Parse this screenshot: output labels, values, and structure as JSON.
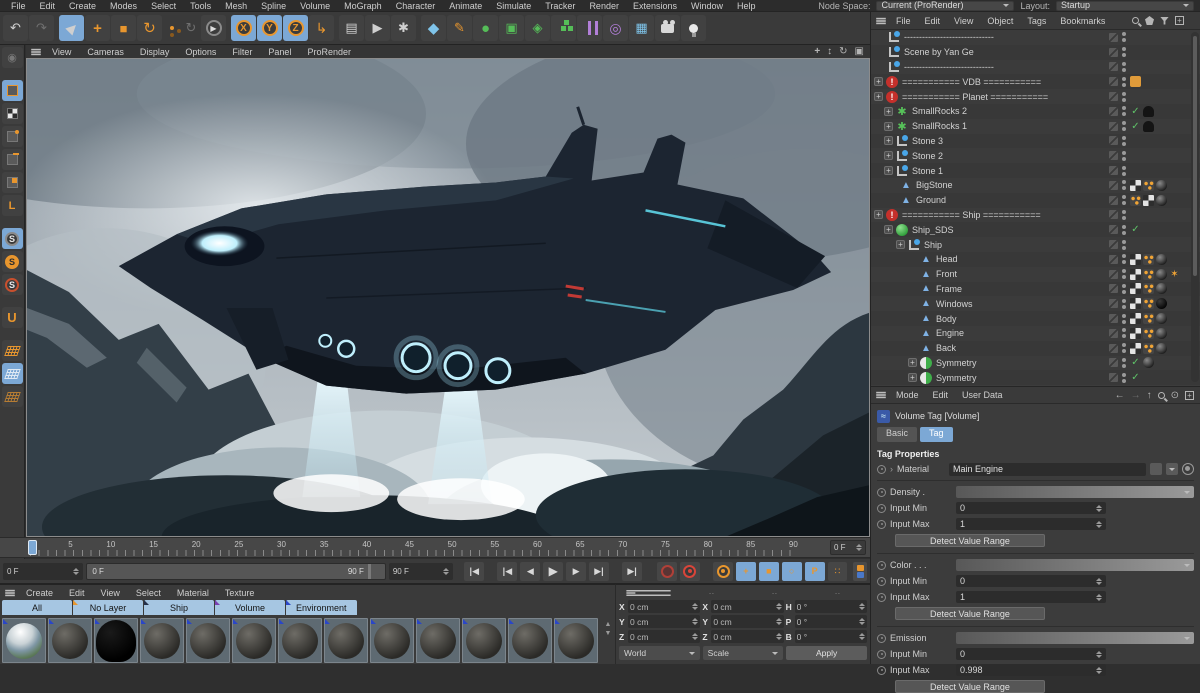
{
  "colors": {
    "highlight_blue": "#7ca8d5",
    "accent_orange": "#e8962e",
    "alert_red": "#c5302b",
    "check_green": "#5fc268",
    "tab_blue": "#a6c6e2",
    "engine_cyan": "#bfeffc"
  },
  "menubar": {
    "items": [
      "File",
      "Edit",
      "Create",
      "Modes",
      "Select",
      "Tools",
      "Mesh",
      "Spline",
      "Volume",
      "MoGraph",
      "Character",
      "Animate",
      "Simulate",
      "Tracker",
      "Render",
      "Extensions",
      "Window",
      "Help"
    ],
    "node_space_label": "Node Space:",
    "node_space_value": "Current (ProRender)",
    "layout_label": "Layout:",
    "layout_value": "Startup"
  },
  "icons": {
    "undo": "↶",
    "redo": "↷",
    "select": "▶",
    "move": "+",
    "scale": "■",
    "rotate": "↻",
    "x": "X",
    "y": "Y",
    "z": "Z",
    "axis": "↳",
    "render_view": "▤",
    "render_play": "▶",
    "render_settings": "✱",
    "cube": "◆",
    "pen": "✎",
    "sds": "●",
    "instance": "▣",
    "deform": "◈",
    "torus": "◎",
    "floor": "▦",
    "pan": "+",
    "dolly": "↕",
    "orbit": "↻",
    "maximize": "▣"
  },
  "viewport": {
    "menu": [
      "View",
      "Cameras",
      "Display",
      "Options",
      "Filter",
      "Panel",
      "ProRender"
    ]
  },
  "object_manager": {
    "menu": [
      "File",
      "Edit",
      "View",
      "Object",
      "Tags",
      "Bookmarks"
    ],
    "items": [
      {
        "label": "------------------------------"
      },
      {
        "label": "Scene by Yan Ge"
      },
      {
        "label": "------------------------------"
      },
      {
        "label": "=========== VDB ==========="
      },
      {
        "label": "=========== Planet ==========="
      },
      {
        "label": "SmallRocks 2"
      },
      {
        "label": "SmallRocks 1"
      },
      {
        "label": "Stone 3"
      },
      {
        "label": "Stone 2"
      },
      {
        "label": "Stone 1"
      },
      {
        "label": "BigStone"
      },
      {
        "label": "Ground"
      },
      {
        "label": "=========== Ship ==========="
      },
      {
        "label": "Ship_SDS"
      },
      {
        "label": "Ship"
      },
      {
        "label": "Head"
      },
      {
        "label": "Front"
      },
      {
        "label": "Frame"
      },
      {
        "label": "Windows"
      },
      {
        "label": "Body"
      },
      {
        "label": "Engine"
      },
      {
        "label": "Back"
      },
      {
        "label": "Symmetry"
      },
      {
        "label": "Symmetry"
      }
    ]
  },
  "attributes": {
    "menu": [
      "Mode",
      "Edit",
      "User Data"
    ],
    "title": "Volume Tag [Volume]",
    "tabs": {
      "basic": "Basic",
      "tag": "Tag"
    },
    "section": "Tag Properties",
    "material_label": "Material",
    "material_value": "Main Engine",
    "detect_label": "Detect Value Range",
    "groups": [
      {
        "name": "Density .",
        "min_label": "Input Min",
        "min": "0",
        "max_label": "Input Max",
        "max": "1"
      },
      {
        "name": "Color . . .",
        "min_label": "Input Min",
        "min": "0",
        "max_label": "Input Max",
        "max": "1"
      },
      {
        "name": "Emission",
        "min_label": "Input Min",
        "min": "0",
        "max_label": "Input Max",
        "max": "0.998"
      }
    ]
  },
  "timeline": {
    "ticks": [
      "0",
      "5",
      "10",
      "15",
      "20",
      "25",
      "30",
      "35",
      "40",
      "45",
      "50",
      "55",
      "60",
      "65",
      "70",
      "75",
      "80",
      "85",
      "90"
    ],
    "end_box": "0 F",
    "current": "0 F",
    "range_start": "0 F",
    "range_end": "90 F",
    "end": "90 F",
    "transport_glyphs": {
      "goto_start": "◀",
      "prev_key": "◀",
      "prev_frame": "◀",
      "play": "▶",
      "next_frame": "▶",
      "next_key": "▶",
      "goto_end": "▶",
      "pos": "+",
      "scl": "■",
      "rot": "○",
      "param": "P",
      "pla": "∷"
    }
  },
  "materials": {
    "menu": [
      "Create",
      "Edit",
      "View",
      "Select",
      "Material",
      "Texture"
    ],
    "tabs": [
      {
        "label": "All"
      },
      {
        "label": "No Layer",
        "corner": "#e8962e"
      },
      {
        "label": "Ship",
        "corner": "#25304a"
      },
      {
        "label": "Volume",
        "corner": "#7a3fb0"
      },
      {
        "label": "Environment",
        "corner": "#2a46c8"
      }
    ],
    "thumb_count": 13
  },
  "coordinates": {
    "headers": [
      "··",
      "··",
      "··"
    ],
    "pos": {
      "xl": "X",
      "x": "0 cm",
      "yl": "Y",
      "y": "0 cm",
      "zl": "Z",
      "z": "0 cm"
    },
    "size": {
      "xl": "X",
      "x": "0 cm",
      "yl": "Y",
      "y": "0 cm",
      "zl": "Z",
      "z": "0 cm"
    },
    "rot": {
      "hl": "H",
      "h": "0 °",
      "pl": "P",
      "p": "0 °",
      "bl": "B",
      "b": "0 °"
    },
    "world": "World",
    "scale": "Scale",
    "apply": "Apply"
  }
}
